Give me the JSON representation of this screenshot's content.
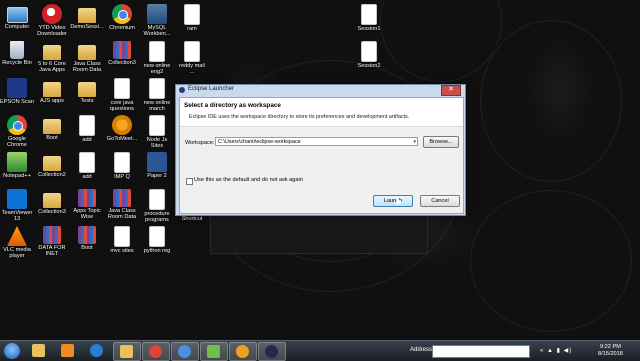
{
  "desktop": {
    "icons": [
      {
        "label": "Computer",
        "type": "pc"
      },
      {
        "label": "YTD Video\nDownloader",
        "type": "yt"
      },
      {
        "label": "DemoSessi...",
        "type": "folder"
      },
      {
        "label": "Chromium",
        "type": "chrome"
      },
      {
        "label": "MySQL\nWorkben...",
        "type": "mysql"
      },
      {
        "label": "ram",
        "type": "doc"
      },
      {
        "label": "Session1",
        "type": "doc"
      },
      {
        "label": "Recycle Bin",
        "type": "bin"
      },
      {
        "label": "5 to 6 Core\nJava Apps",
        "type": "folder"
      },
      {
        "label": "Java Class\nRoom Data",
        "type": "folder"
      },
      {
        "label": "Collection3",
        "type": "zip"
      },
      {
        "label": "new online\neng2",
        "type": "doc"
      },
      {
        "label": "reddy mail\n...",
        "type": "doc"
      },
      {
        "label": "Session2",
        "type": "doc"
      },
      {
        "label": "EPSON Scan",
        "type": "epson"
      },
      {
        "label": "AJS apps",
        "type": "folder"
      },
      {
        "label": "Tests",
        "type": "folder"
      },
      {
        "label": "core java\nquestions",
        "type": "doc"
      },
      {
        "label": "new online\nmarch",
        "type": "doc"
      },
      {
        "label": "Google\nChrome",
        "type": "chrome"
      },
      {
        "label": "Boot",
        "type": "folder"
      },
      {
        "label": "add",
        "type": "doc"
      },
      {
        "label": "GoToMeet...",
        "type": "gtm"
      },
      {
        "label": "Node Js Sites",
        "type": "doc"
      },
      {
        "label": "Notepad++",
        "type": "np"
      },
      {
        "label": "Collection2",
        "type": "folder"
      },
      {
        "label": "add",
        "type": "doc"
      },
      {
        "label": "IMP Q",
        "type": "doc"
      },
      {
        "label": "Paper 2",
        "type": "word"
      },
      {
        "label": "Zoom",
        "type": "zoom"
      },
      {
        "label": "TeamViewer\n13",
        "type": "tv"
      },
      {
        "label": "Collection3",
        "type": "folder"
      },
      {
        "label": "Apps Topic\nWise",
        "type": "zip"
      },
      {
        "label": "Java Class\nRoom Data",
        "type": "zip"
      },
      {
        "label": "procedure\nprograms",
        "type": "doc"
      },
      {
        "label": "eclipse -\nShortcut",
        "type": "eclipse"
      },
      {
        "label": "VLC media\nplayer",
        "type": "vlc"
      },
      {
        "label": "DATA FOR\nINET",
        "type": "zip"
      },
      {
        "label": "Boot",
        "type": "zip"
      },
      {
        "label": "mvc sites",
        "type": "doc"
      },
      {
        "label": "python reg",
        "type": "doc"
      }
    ]
  },
  "dialog": {
    "window_title": "Eclipse Launcher",
    "close_glyph": "✕",
    "header_title": "Select a directory as workspace",
    "header_desc": "Eclipse IDE uses the workspace directory to store its preferences and development artifacts.",
    "workspace_label": "Workspace:",
    "workspace_value": "C:\\Users\\chanti\\eclipse-workspace",
    "combo_arrow": "▾",
    "browse_label": "Browse...",
    "default_checkbox_label": "Use this as the default and do not ask again",
    "default_checked": false,
    "launch_label": "Launch",
    "cancel_label": "Cancel"
  },
  "taskbar": {
    "address_label": "Address",
    "tray_glyphs": "« ▲ ▮ ◀)",
    "time": "9:22 PM",
    "date": "8/15/2018",
    "apps": [
      "explorer",
      "media",
      "ie",
      "folder",
      "chrome",
      "chromium",
      "notepad",
      "gotomeeting",
      "eclipse"
    ]
  }
}
